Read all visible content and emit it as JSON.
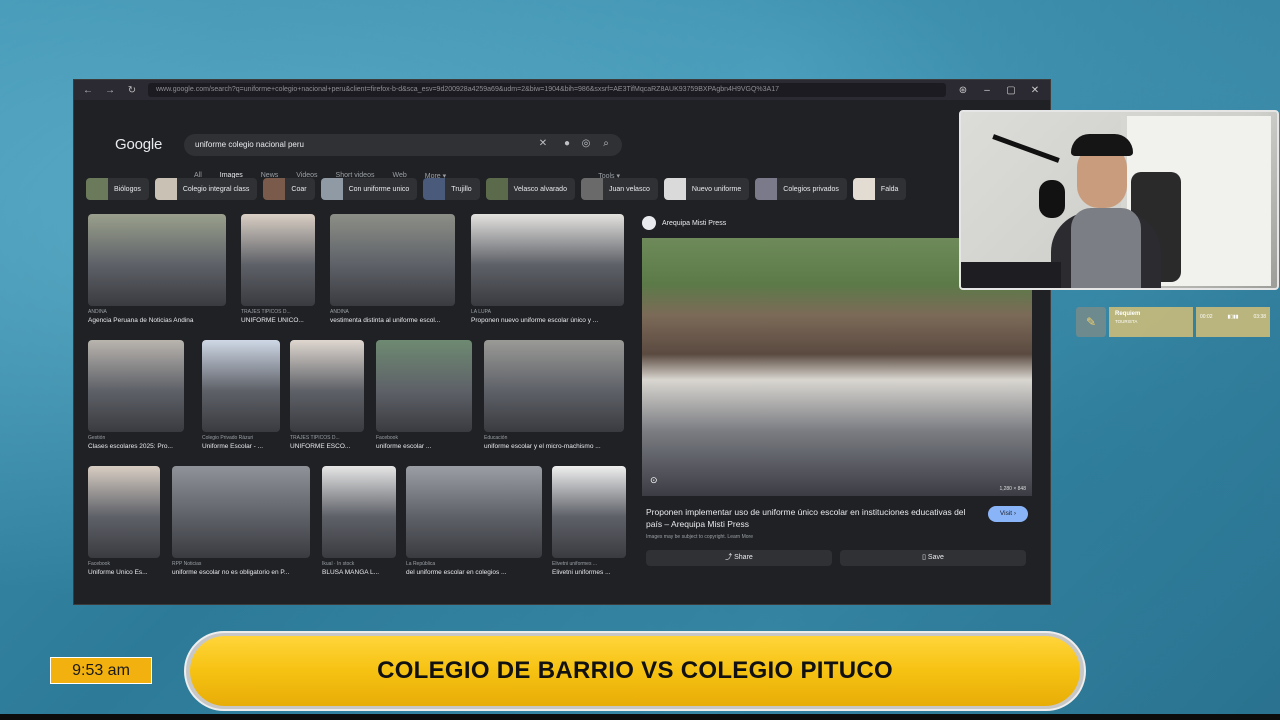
{
  "browser": {
    "url": "www.google.com/search?q=uniforme+colegio+nacional+peru&client=firefox-b-d&sca_esv=9d200928a4259a69&udm=2&biw=1904&bih=986&sxsrf=AE3TifMqcaRZ8AUK93759BXPAgbn4H9VGQ%3A17",
    "google_logo": "Google",
    "search_query": "uniforme colegio nacional peru",
    "tabs": [
      "All",
      "Images",
      "News",
      "Videos",
      "Short videos",
      "Web",
      "More ▾"
    ],
    "active_tab": "Images",
    "tools_label": "Tools ▾",
    "chips": [
      {
        "label": "Biólogos",
        "color": "#6b7a5a"
      },
      {
        "label": "Colegio integral class",
        "color": "#c9c1b4"
      },
      {
        "label": "Coar",
        "color": "#7a5a4a"
      },
      {
        "label": "Con uniforme unico",
        "color": "#8f9aa4"
      },
      {
        "label": "Trujillo",
        "color": "#4a5a7a"
      },
      {
        "label": "Velasco alvarado",
        "color": "#5a6a4a"
      },
      {
        "label": "Juan velasco",
        "color": "#6a6a6a"
      },
      {
        "label": "Nuevo uniforme",
        "color": "#dadada"
      },
      {
        "label": "Colegios privados",
        "color": "#7a7a8a"
      },
      {
        "label": "Falda",
        "color": "#e2dcd2"
      }
    ],
    "results": [
      {
        "source": "ANDINA",
        "caption": "Agencia Peruana de Noticias Andina",
        "color": "#9aa08c"
      },
      {
        "source": "TRAJES TIPICOS D...",
        "caption": "UNIFORME UNICO...",
        "color": "#d9cfc4"
      },
      {
        "source": "ANDINA",
        "caption": "vestimenta distinta al uniforme escol...",
        "color": "#8c8f86"
      },
      {
        "source": "LA LUPA",
        "caption": "Proponen nuevo uniforme escolar único y ...",
        "color": "#e4e2df"
      },
      {
        "source": "Gestión",
        "caption": "Clases escolares 2025: Pro...",
        "color": "#b9b4ae"
      },
      {
        "source": "Colegio Privado Rázuri",
        "caption": "Uniforme Escolar - ...",
        "color": "#cfd8e6"
      },
      {
        "source": "TRAJES TIPICOS D...",
        "caption": "UNIFORME ESCO...",
        "color": "#dfd7cf"
      },
      {
        "source": "Facebook",
        "caption": "uniforme escolar ...",
        "color": "#6e8a72"
      },
      {
        "source": "Educación",
        "caption": "uniforme escolar y el micro-machismo ...",
        "color": "#9a9a96"
      },
      {
        "source": "Facebook",
        "caption": "Uniforme Unico Es...",
        "color": "#d8cdc3"
      },
      {
        "source": "RPP Noticias",
        "caption": "uniforme escolar no es obligatorio en P...",
        "color": "#8f9399"
      },
      {
        "source": "Ikual · In stock",
        "caption": "BLUSA MANGA L...",
        "color": "#e6e6e6"
      },
      {
        "source": "La República",
        "caption": "del uniforme escolar en colegios ...",
        "color": "#9b9ea5"
      },
      {
        "source": "Elivetni uniformes ...",
        "caption": "Elivetni uniformes ...",
        "color": "#efefef"
      }
    ],
    "panel": {
      "source": "Arequipa Misti Press",
      "size_label": "1,280 × 848",
      "title": "Proponen implementar uso de uniforme único escolar en instituciones educativas del país – Arequipa Misti Press",
      "visit_label": "Visit ›",
      "copyright": "Images may be subject to copyright. Learn More",
      "share_label": "Share",
      "save_label": "Save"
    }
  },
  "music": {
    "song": "Requiem",
    "artist": "TOURISTA",
    "elapsed": "00:02",
    "total": "03:38"
  },
  "clock": "9:53 am",
  "banner": "COLEGIO DE BARRIO VS COLEGIO PITUCO"
}
